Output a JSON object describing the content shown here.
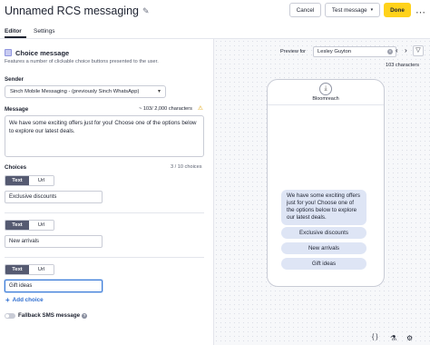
{
  "header": {
    "title": "Unnamed RCS messaging",
    "cancel_label": "Cancel",
    "test_message_label": "Test message",
    "done_label": "Done"
  },
  "tabs": [
    {
      "label": "Editor",
      "active": true
    },
    {
      "label": "Settings",
      "active": false
    }
  ],
  "editor": {
    "block_title": "Choice message",
    "block_description": "Features a number of clickable choice buttons presented to the user.",
    "sender_label": "Sender",
    "sender_value": "Sinch Mobile Messaging - (previously Sinch WhatsApp)",
    "message_label": "Message",
    "message_counter": "~ 103/ 2,000 characters",
    "message_text": "We have some exciting offers just for you! Choose one of the options below to explore our latest deals.",
    "choices_label": "Choices",
    "choices_counter": "3 / 10 choices",
    "choices": [
      {
        "type_options": [
          "Text",
          "Url"
        ],
        "selected_type": "Text",
        "value": "Exclusive discounts"
      },
      {
        "type_options": [
          "Text",
          "Url"
        ],
        "selected_type": "Text",
        "value": "New arrivals"
      },
      {
        "type_options": [
          "Text",
          "Url"
        ],
        "selected_type": "Text",
        "value": "Gift ideas"
      }
    ],
    "add_choice_label": "Add choice",
    "fallback_label": "Fallback SMS message",
    "fallback_enabled": false
  },
  "preview": {
    "preview_for_label": "Preview for",
    "preview_for_value": "Lesley Guyton",
    "char_count": "103 characters",
    "brand_name": "Bloomreach",
    "message_text": "We have some exciting offers just for you! Choose one of the options below to explore our latest deals.",
    "chips": [
      "Exclusive discounts",
      "New arrivals",
      "Gift ideas"
    ]
  },
  "icons": {
    "edit": "pencil-icon",
    "more": "more-horizontal-icon",
    "block": "choice-block-icon",
    "warning": "warning-icon",
    "add": "plus-icon",
    "help": "help-icon",
    "clear": "clear-icon",
    "prev": "chevron-left-icon",
    "next": "chevron-right-icon",
    "filter": "filter-icon",
    "code": "code-braces-icon",
    "flask": "flask-icon",
    "settings": "gear-icon"
  },
  "colors": {
    "accent_yellow": "#ffd21a",
    "segment_active": "#555a71",
    "link_blue": "#2f6ed0",
    "bubble": "#dee5f5"
  }
}
